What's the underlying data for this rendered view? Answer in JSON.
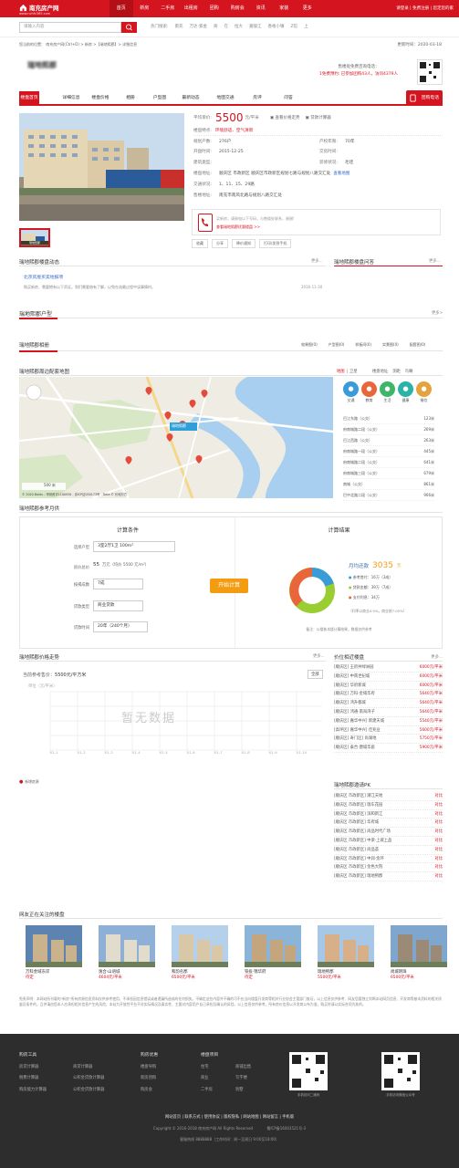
{
  "topbar": {
    "logo_title": "南充房产网",
    "logo_url": "www.nchfc365.com",
    "nav": [
      "首页",
      "新房",
      "二手房",
      "出租房",
      "团购",
      "购房会",
      "资讯",
      "家装",
      "更多"
    ],
    "links": "请登录 | 免费注册 | 您定您的家"
  },
  "search": {
    "placeholder": "请输入内容",
    "hot_label": "热门搜索:",
    "hot": [
      "南充",
      "万达·紫金",
      "阆",
      "在",
      "恒大",
      "嘉陵江",
      "香格小镇",
      "Z馆",
      "上"
    ]
  },
  "breadcrumb": "您当前的位置： 南充房产网(Ctrl+D) > 新房 >【瑞地熙郡】> 详细信息",
  "update_label": "更新时间：",
  "update_date": "2020-03-18",
  "building": {
    "name": "瑞地熙郡",
    "consult_label": "售楼处免费咨询电话：",
    "consult_note": "1免费预约: 已参加团购43人，访问4379人"
  },
  "tabs": [
    "楼盘首页",
    "详细信息",
    "楼盘价格",
    "相册",
    "户型图",
    "最新动态",
    "地图交通",
    "房评",
    "问答"
  ],
  "group_buy": "团购电话",
  "info": {
    "avg_label": "平均单价:",
    "avg_price": "5500",
    "avg_unit": "元/平米",
    "price_trend": "查看价格走势",
    "loan_calc": "贷款计算器",
    "feature_label": "楼盘特点:",
    "feature": "环境舒适、空气清新",
    "households_label": "规划户数:",
    "households": "276户",
    "years_label": "产权年限:",
    "years": "70年",
    "open_label": "开盘时间:",
    "open": "2015-12-25",
    "deliver_label": "交房时间:",
    "deliver": "",
    "type_label": "建筑类型:",
    "type": "",
    "deco_label": "装修状况:",
    "deco": "毛坯",
    "addr_label": "楼盘地址:",
    "addr": "顺庆区 市政新区 顺庆区市政新区规划七路与规划八路交汇处",
    "map_link": "查看地图",
    "traffic_label": "交通状况:",
    "traffic": "1、11、15、29路",
    "sales_label": "售楼地址:",
    "sales": "南充市南风北路与规划八路交汇处",
    "call_text": "买新房，请致电以下号码，与售楼处联系，谢谢!",
    "call_link": "查看瑞地熙郡优惠楼盘 >>"
  },
  "actions": [
    "收藏",
    "分享",
    "降价通知",
    "打印/发到手机"
  ],
  "photo_caption": "瑞地熙郡",
  "dyn": {
    "title": "瑞地熙郡楼盘动态",
    "more": "更多...",
    "news_title": "北京房屋买卖地报项",
    "news_desc": "购买新房、需要拥有以下资证。到们需要借有了解，以免在选最过程中误事情时。",
    "news_date": "2016-11-30",
    "qa_title": "瑞地熙郡楼盘问答",
    "qa_more": "更多..."
  },
  "layout": {
    "title": "瑞地熙郡户型",
    "more": "更多>"
  },
  "album": {
    "title": "瑞地熙郡相册",
    "cats": [
      "效果图(0)",
      "户型图(0)",
      "样板间(0)",
      "实景图(0)",
      "配套图(0)"
    ]
  },
  "map": {
    "title": "瑞地熙郡周边配套地图",
    "switch": [
      "地图",
      "|",
      "卫星"
    ],
    "opts": [
      "楼盘地址",
      "测距",
      "鸟瞰"
    ],
    "marker": "瑞地熙郡",
    "copyright": "© 2020 Baidu - 甲测资字1100930 - 京ICP证030173号 - Data © 长地万方",
    "scale": "500 米",
    "poi_icons": [
      {
        "label": "交通",
        "color": "#3a9bd9"
      },
      {
        "label": "教育",
        "color": "#e8663a"
      },
      {
        "label": "生活",
        "color": "#3db66a"
      },
      {
        "label": "健康",
        "color": "#2bb3a8"
      },
      {
        "label": "餐饮",
        "color": "#e6a23c"
      }
    ],
    "poi": [
      {
        "name": "巴江东路（公交）",
        "dist": "123米"
      },
      {
        "name": "府南城路二段（公交）",
        "dist": "269米"
      },
      {
        "name": "巴江西路（公交）",
        "dist": "263米"
      },
      {
        "name": "府南城路一段（公交）",
        "dist": "445米"
      },
      {
        "name": "府南城路二段（公交）",
        "dist": "641米"
      },
      {
        "name": "府南城路三段（公交）",
        "dist": "679米"
      },
      {
        "name": "南城（公交）",
        "dist": "861米"
      },
      {
        "name": "巴中北路二段（公交）",
        "dist": "906米"
      }
    ]
  },
  "calc": {
    "title": "瑞地熙郡参考月供",
    "cond_title": "计算条件",
    "result_title": "计算结果",
    "house_label": "选择户型",
    "house": "3室2厅1卫 100m²",
    "total_label": "房价总价",
    "total": "55",
    "total_unit": "万元（均价 5500 元/m²）",
    "down_label": "按揭成数",
    "down": "7成",
    "loan_label": "贷款类型",
    "loan": "商业贷款",
    "years_label": "贷款时间",
    "years": "20年（240个月）",
    "start": "开始计算",
    "monthly_label": "月均还款",
    "monthly": "3035",
    "monthly_unit": "元",
    "legend": [
      {
        "label": "参考首付：16万（3成）",
        "color": "#3a9bd9"
      },
      {
        "label": "贷款金额：39万（7成）",
        "color": "#9acd32"
      },
      {
        "label": "支付利息：34万",
        "color": "#e8663a"
      }
    ],
    "rate_note": "（利率以商业4.9%，商业按7.05%）",
    "note": "备注：以楼栋本楼计算结果，数据仅供参考"
  },
  "trend": {
    "title": "瑞地熙郡价格走势",
    "more": "更多...",
    "ref_label": "当前参考售价：",
    "ref_price": "5500元/平方米",
    "all_btn": "全部",
    "ylabel": "单位（元/平米）",
    "no_data": "暂无数据",
    "x": [
      "01-1",
      "01-2",
      "01-3",
      "01-4",
      "01-5",
      "01-6",
      "01-7",
      "01-8",
      "01-9",
      "01-10"
    ],
    "legend": "新增房源"
  },
  "pricelist": {
    "title": "价位相近楼盘",
    "more": "更多...",
    "items": [
      {
        "name": "[顺庆区] 王府井绿洲园",
        "price": "6000元/平米"
      },
      {
        "name": "[顺庆区] 中南世纪城",
        "price": "6000元/平米"
      },
      {
        "name": "[顺庆区] 华府新城",
        "price": "6000元/平米"
      },
      {
        "name": "[顺庆区] 万科·金域华府",
        "price": "5640元/平米"
      },
      {
        "name": "[顺庆区] 鸿升都城",
        "price": "5640元/平米"
      },
      {
        "name": "[顺庆区] 鸿通·南海湾子",
        "price": "5640元/平米"
      },
      {
        "name": "[顺庆区] 嘉华中兴] 新建天城",
        "price": "5540元/平米"
      },
      {
        "name": "[高坪区] 嘉华中兴] 佳兆业",
        "price": "5600元/平米"
      },
      {
        "name": "[顺庆区] 寿门区] 尚湖地",
        "price": "5750元/平米"
      },
      {
        "name": "[顺庆区] 泰合·唐城华庭",
        "price": "5900元/平米"
      }
    ]
  },
  "pk": {
    "title": "瑞地熙郡邀请PK",
    "items": [
      {
        "name": "[顺庆区 市政新区] 潮江天地",
        "op": "对比"
      },
      {
        "name": "[顺庆区 市政新区] 瑞车花园",
        "op": "对比"
      },
      {
        "name": "[顺庆区 市政新区] 滨和新江",
        "op": "对比"
      },
      {
        "name": "[顺庆区 市政新区] 华府城",
        "op": "对比"
      },
      {
        "name": "[顺庆区 市政新区] 尚品时代广场",
        "op": "对比"
      },
      {
        "name": "[顺庆区 市政新区] 中梁·上城上品",
        "op": "对比"
      },
      {
        "name": "[顺庆区 市政新区] 尚品荟",
        "op": "对比"
      },
      {
        "name": "[顺庆区 市政新区] 中润·金环",
        "op": "对比"
      },
      {
        "name": "[顺庆区 市政新区] 金色大院",
        "op": "对比"
      },
      {
        "name": "[顺庆区 市政新区] 瑞地熙郡",
        "op": "对比"
      }
    ]
  },
  "watch": {
    "title": "网友正在关注的楼盘",
    "items": [
      {
        "name": "万科金域东岸",
        "price": "待定"
      },
      {
        "name": "逸合·山语城",
        "price": "4604元/平米"
      },
      {
        "name": "和韵名郡",
        "price": "6500元/平米"
      },
      {
        "name": "铁投·锦华府",
        "price": "待定"
      },
      {
        "name": "瑞地熙郡",
        "price": "5500元/平米"
      },
      {
        "name": "尚城明珠",
        "price": "6500元/平米"
      }
    ]
  },
  "disclaimer": "免责声明：本网站所刊载的\"新房\"所有房源信息资料仅供参考使用，不承担因信息错误或者遗漏所造成的任何损失。不确定这些内容并不确的可不应当向楼盘开发商等相关行业协会主管部门查证，以上信息仅供参考、网友您要独立判断本站网页信息、开发商等基本资料的相关质量及条件的，且供请由您本人应承担相关信息产生的风险，本站为开放性平台不对实际情况及真实性、主要对内容用户自己承担及确认的风险。以上信息仅供参考。所有房价信息以开发商公布为准，购买时请以实际合同为准的。",
  "footer": {
    "cols": [
      {
        "title": "购房工具",
        "items": [
          "房贷计算器",
          "税费计算器",
          "购房能力计算器"
        ]
      },
      {
        "title": "",
        "items": [
          "商贷计算器",
          "公积金贷款计算器",
          "公积金贷款计算器"
        ]
      },
      {
        "title": "购房优惠",
        "items": [
          "楼盘导购",
          "新房团购",
          "购房会"
        ]
      },
      {
        "title": "楼盘项目",
        "items": [
          "住宅",
          "商业",
          "二手房"
        ]
      },
      {
        "title": "",
        "items": [
          "商铺出售",
          "写字楼",
          "别墅"
        ]
      }
    ],
    "qr1": "手机访问二维码",
    "qr2": "手机访问微信公众号",
    "links": "网站首页 | 联系方式 | 使用协议 | 版权隐私 | 网站地图 | 网站留言 | 手机版",
    "copy": "Copyright © 2016-2018 南充房产网 All Rights Reserved",
    "icp": "蜀ICP备16003521号-3",
    "hotline": "客服热线 8888888（工作时间：周一至周日 9:00至18:00）"
  }
}
